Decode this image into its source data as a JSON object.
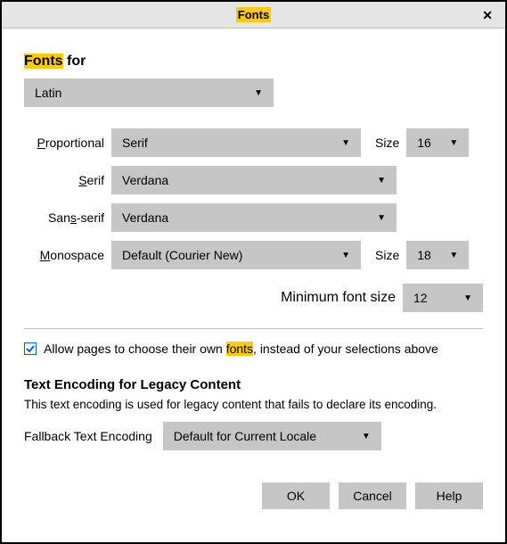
{
  "titlebar": {
    "title": "Fonts"
  },
  "fontsFor": {
    "label_prefix": "Fonts",
    "label_suffix": " for",
    "value": "Latin"
  },
  "rows": {
    "proportional": {
      "label_pre": "P",
      "label_rest": "roportional",
      "value": "Serif",
      "size_label": "Size",
      "size_value": "16"
    },
    "serif": {
      "label_pre": "S",
      "label_rest": "erif",
      "value": "Verdana"
    },
    "sansserif": {
      "label_pre": "San",
      "label_u": "s",
      "label_post": "-serif",
      "value": "Verdana"
    },
    "monospace": {
      "label_pre": "M",
      "label_rest": "onospace",
      "value": "Default (Courier New)",
      "size_label": "Size",
      "size_value": "18"
    }
  },
  "minFont": {
    "label_pre": "Minimum f",
    "label_u": "o",
    "label_post": "nt size",
    "value": "12"
  },
  "allowPages": {
    "pre": "A",
    "mid1": "llow pages to choose their own ",
    "hl": "fonts",
    "post": ", instead of your selections above"
  },
  "encoding": {
    "title": "Text Encoding for Legacy Content",
    "desc": "This text encoding is used for legacy content that fails to declare its encoding.",
    "label_pre": "Fallback ",
    "label_u": "T",
    "label_post": "ext Encoding",
    "value": "Default for Current Locale"
  },
  "buttons": {
    "ok": "OK",
    "cancel": "Cancel",
    "help_u": "H",
    "help_rest": "elp"
  }
}
